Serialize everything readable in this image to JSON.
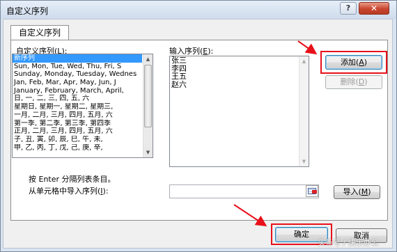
{
  "dialog": {
    "title": "自定义序列",
    "help_glyph": "?",
    "close_glyph": "✕"
  },
  "tab": {
    "label": "自定义序列"
  },
  "custom_list": {
    "label_prefix": "自定义序列(",
    "label_key": "L",
    "label_suffix": "):",
    "items": [
      "新序列",
      "Sun, Mon, Tue, Wed, Thu, Fri, S",
      "Sunday, Monday, Tuesday, Wednes",
      "Jan, Feb, Mar, Apr, May, Jun, J",
      "January, February, March, April,",
      "日, 一, 二, 三, 四, 五, 六",
      "星期日, 星期一, 星期二, 星期三,",
      "一月, 二月, 三月, 四月, 五月, 六",
      "第一季, 第二季, 第三季, 第四季",
      "正月, 二月, 三月, 四月, 五月, 六",
      "子, 丑, 寅, 卯, 辰, 巳, 午, 未,",
      "甲, 乙, 丙, 丁, 戊, 己, 庚, 辛,"
    ],
    "selected_index": 0
  },
  "entries": {
    "label_prefix": "输入序列(",
    "label_key": "E",
    "label_suffix": "):",
    "lines": [
      "张三",
      "李四",
      "王五",
      "赵六"
    ]
  },
  "buttons": {
    "add": {
      "text": "添加(",
      "key": "A",
      "tail": ")"
    },
    "delete": {
      "text": "删除(",
      "key": "D",
      "tail": ")"
    },
    "import": {
      "text": "导入(",
      "key": "M",
      "tail": ")"
    },
    "ok": "确定",
    "cancel": "取消"
  },
  "hint": "按 Enter 分隔列表条目。",
  "import_label": {
    "prefix": "从单元格中导入序列(",
    "key": "I",
    "suffix": "):"
  },
  "watermark": "头条号 / 快乐办公",
  "colors": {
    "highlight": "#e8101a",
    "selection": "#3399ff"
  }
}
